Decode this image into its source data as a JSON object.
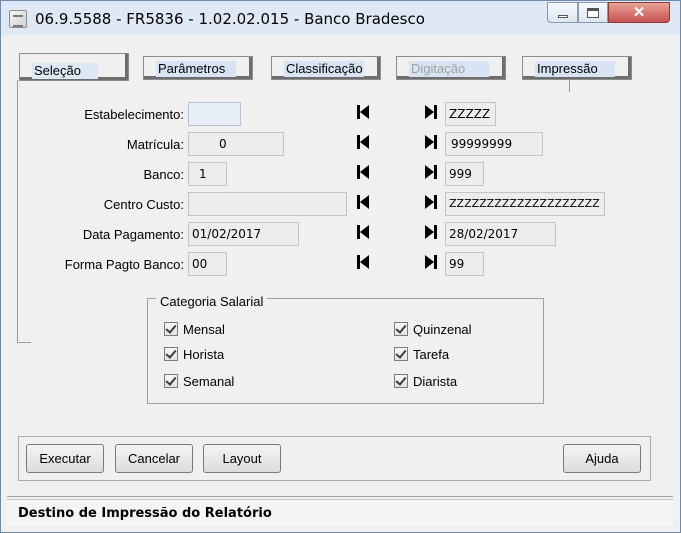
{
  "window": {
    "title": "06.9.5588 - FR5836 - 1.02.02.015 - Banco Bradesco",
    "minimize_glyph": "",
    "close_glyph": "✕"
  },
  "tabs": [
    {
      "label": "Seleção",
      "state": "active"
    },
    {
      "label": "Parâmetros",
      "state": "normal"
    },
    {
      "label": "Classificação",
      "state": "normal"
    },
    {
      "label": "Digitação",
      "state": "disabled"
    },
    {
      "label": "Impressão",
      "state": "normal"
    }
  ],
  "form": {
    "estabelecimento": {
      "label": "Estabelecimento:",
      "from": "",
      "to": "ZZZZZ"
    },
    "matricula": {
      "label": "Matrícula:",
      "from": "0",
      "to": "99999999"
    },
    "banco": {
      "label": "Banco:",
      "from": "1",
      "to": "999"
    },
    "centro_custo": {
      "label": "Centro Custo:",
      "from": "",
      "to": "ZZZZZZZZZZZZZZZZZZZZ"
    },
    "data_pagamento": {
      "label": "Data Pagamento:",
      "from": "01/02/2017",
      "to": "28/02/2017"
    },
    "forma_pagto": {
      "label": "Forma Pagto Banco:",
      "from": "00",
      "to": "99"
    }
  },
  "categoria": {
    "title": "Categoria Salarial",
    "items": [
      {
        "label": "Mensal",
        "checked": true
      },
      {
        "label": "Quinzenal",
        "checked": true
      },
      {
        "label": "Horista",
        "checked": true
      },
      {
        "label": "Tarefa",
        "checked": true
      },
      {
        "label": "Semanal",
        "checked": true
      },
      {
        "label": "Diarista",
        "checked": true
      }
    ]
  },
  "buttons": {
    "executar": "Executar",
    "cancelar": "Cancelar",
    "layout": "Layout",
    "ajuda": "Ajuda"
  },
  "status": {
    "text": "Destino de Impressão do Relatório"
  },
  "icons": {
    "app": "app-icon",
    "first": "first-record-icon",
    "last": "last-record-icon"
  }
}
